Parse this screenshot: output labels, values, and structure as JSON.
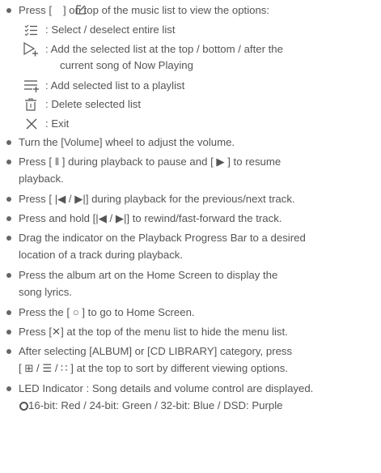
{
  "bullets": {
    "options_intro": "Press [   ] on top of the music list to view the options:",
    "volume": "Turn the [Volume] wheel to adjust the volume.",
    "pause_1": "Press [ ‖ ] during playback to pause and [ ▶ ] to resume",
    "pause_2": "playback.",
    "prev_next": "Press [ |◀ / ▶|] during playback for the previous/next track.",
    "rewind": "Press and hold [|◀ / ▶|] to rewind/fast-forward the track.",
    "drag_1": "Drag the indicator on the Playback Progress Bar to a desired",
    "drag_2": "location of a track during playback.",
    "album_1": "Press the album art on the Home Screen to display the",
    "album_2": "song lyrics.",
    "home": "Press the [ ○ ] to go to Home Screen.",
    "hide_menu": "Press [✕] at the top of the menu list to hide the menu list.",
    "sort_1": "After selecting [ALBUM] or [CD LIBRARY] category, press",
    "sort_2": "[ ⊞ / ☰ / ∷ ] at the top to sort by different viewing options.",
    "led_1": "LED Indicator : Song details and volume control are displayed.",
    "led_2": "16-bit: Red / 24-bit: Green / 32-bit: Blue / DSD: Purple"
  },
  "options": {
    "select": ": Select / deselect entire list",
    "add_now_playing_1": ": Add the selected list at the top / bottom / after the",
    "add_now_playing_2": "current song of Now Playing",
    "add_playlist": ": Add selected list to a playlist",
    "delete": ": Delete selected list",
    "exit": ": Exit"
  },
  "icons": {
    "menu_options": "edit-square-icon",
    "select": "checklist-icon",
    "add_now_playing": "play-add-icon",
    "add_playlist": "playlist-add-icon",
    "delete": "trash-icon",
    "exit": "close-icon",
    "home": "circle-icon",
    "close_menu": "close-icon",
    "sort": "grid-list-icons"
  },
  "colors": {
    "text": "#555555",
    "bullet": "#666666"
  }
}
